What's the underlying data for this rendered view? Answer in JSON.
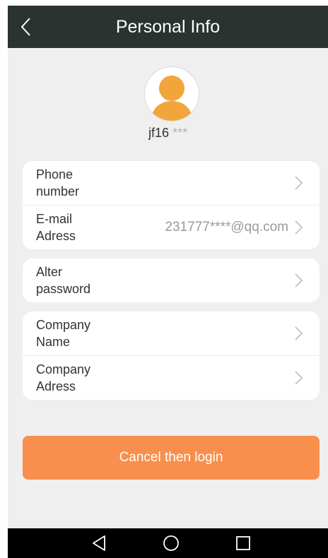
{
  "header": {
    "title": "Personal Info",
    "back_icon": "chevron-left-icon"
  },
  "profile": {
    "avatar_icon": "user-avatar-icon",
    "username_visible": "jf16",
    "username_masked": "***"
  },
  "account_group": [
    {
      "label": "Phone number",
      "value": ""
    },
    {
      "label": "E-mail Adress",
      "value": "231777****@qq.com"
    }
  ],
  "password_group": [
    {
      "label": "Alter password",
      "value": ""
    }
  ],
  "company_group": [
    {
      "label": "Company Name",
      "value": ""
    },
    {
      "label": "Company Adress",
      "value": ""
    }
  ],
  "actions": {
    "cancel_login_label": "Cancel then login"
  },
  "navbar": {
    "back_icon": "triangle-back-icon",
    "home_icon": "circle-home-icon",
    "recents_icon": "square-recents-icon"
  },
  "colors": {
    "header_bg": "#2b3330",
    "accent": "#f98f4c",
    "avatar": "#f2a53a"
  }
}
